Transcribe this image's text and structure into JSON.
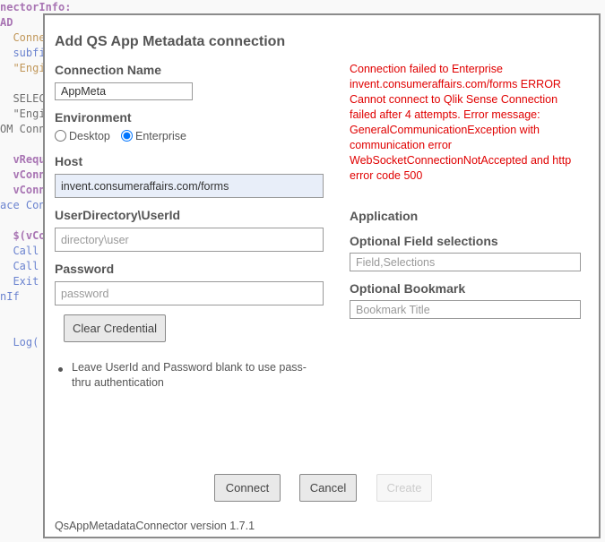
{
  "background_code": {
    "lines": [
      "nectorInfo:",
      "AD",
      "  Conne",
      "  subfi",
      "  \"Engi",
      "  SELEC",
      "  \"Engi",
      "OM Conn",
      "  vReque",
      "  vConn",
      "  vConn",
      "ace Con",
      "  $(vCon",
      "  Call",
      "  Call",
      "  Exit",
      "nIf",
      "  Log("
    ]
  },
  "dialog": {
    "title": "Add QS App Metadata connection",
    "connection_name": {
      "label": "Connection Name",
      "value": "AppMeta"
    },
    "environment": {
      "label": "Environment",
      "options": [
        "Desktop",
        "Enterprise"
      ],
      "selected": "Enterprise"
    },
    "host": {
      "label": "Host",
      "value": "invent.consumeraffairs.com/forms"
    },
    "user": {
      "label": "UserDirectory\\UserId",
      "placeholder": "directory\\user",
      "value": ""
    },
    "password": {
      "label": "Password",
      "placeholder": "password",
      "value": ""
    },
    "clear_credential_label": "Clear Credential",
    "note": "Leave UserId and Password blank to use pass-thru authentication",
    "error_message": "Connection failed to Enterprise invent.consumeraffairs.com/forms ERROR Cannot connect to Qlik Sense Connection failed after 4 attempts. Error message:  GeneralCommunicationException with communication error WebSocketConnectionNotAccepted and http error code 500",
    "application_label": "Application",
    "optional_fields": {
      "label": "Optional Field selections",
      "placeholder": "Field,Selections"
    },
    "optional_bookmark": {
      "label": "Optional Bookmark",
      "placeholder": "Bookmark Title"
    },
    "buttons": {
      "connect": "Connect",
      "cancel": "Cancel",
      "create": "Create"
    },
    "footer": "QsAppMetadataConnector version 1.7.1"
  },
  "colors": {
    "error": "#e00000",
    "host_fill": "#e8eef9",
    "border": "#8b8b8b"
  }
}
